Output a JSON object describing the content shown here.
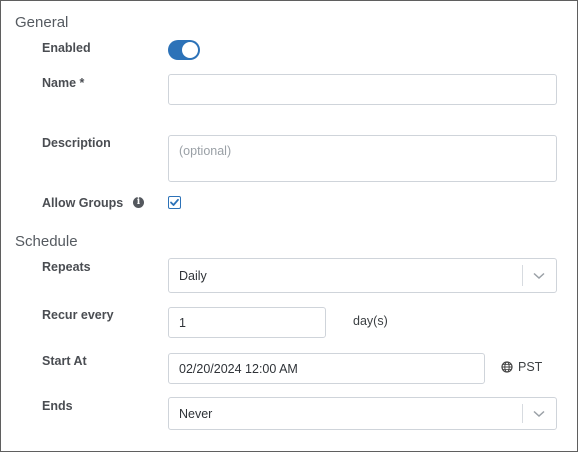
{
  "general": {
    "title": "General",
    "enabled_label": "Enabled",
    "enabled_value": true,
    "name_label": "Name *",
    "name_value": "",
    "description_label": "Description",
    "description_placeholder": "(optional)",
    "allow_groups_label": "Allow Groups",
    "allow_groups_checked": true
  },
  "schedule": {
    "title": "Schedule",
    "repeats_label": "Repeats",
    "repeats_value": "Daily",
    "recur_label": "Recur every",
    "recur_value": "1",
    "recur_unit": "day(s)",
    "start_label": "Start At",
    "start_value": "02/20/2024 12:00 AM",
    "timezone": "PST",
    "ends_label": "Ends",
    "ends_value": "Never"
  },
  "colors": {
    "accent": "#2c72b8",
    "border": "#cfd4da",
    "label": "#4a4d52"
  },
  "icons": {
    "info": "info-icon",
    "globe": "globe-icon",
    "chevron": "chevron-down-icon",
    "check": "check-icon"
  }
}
